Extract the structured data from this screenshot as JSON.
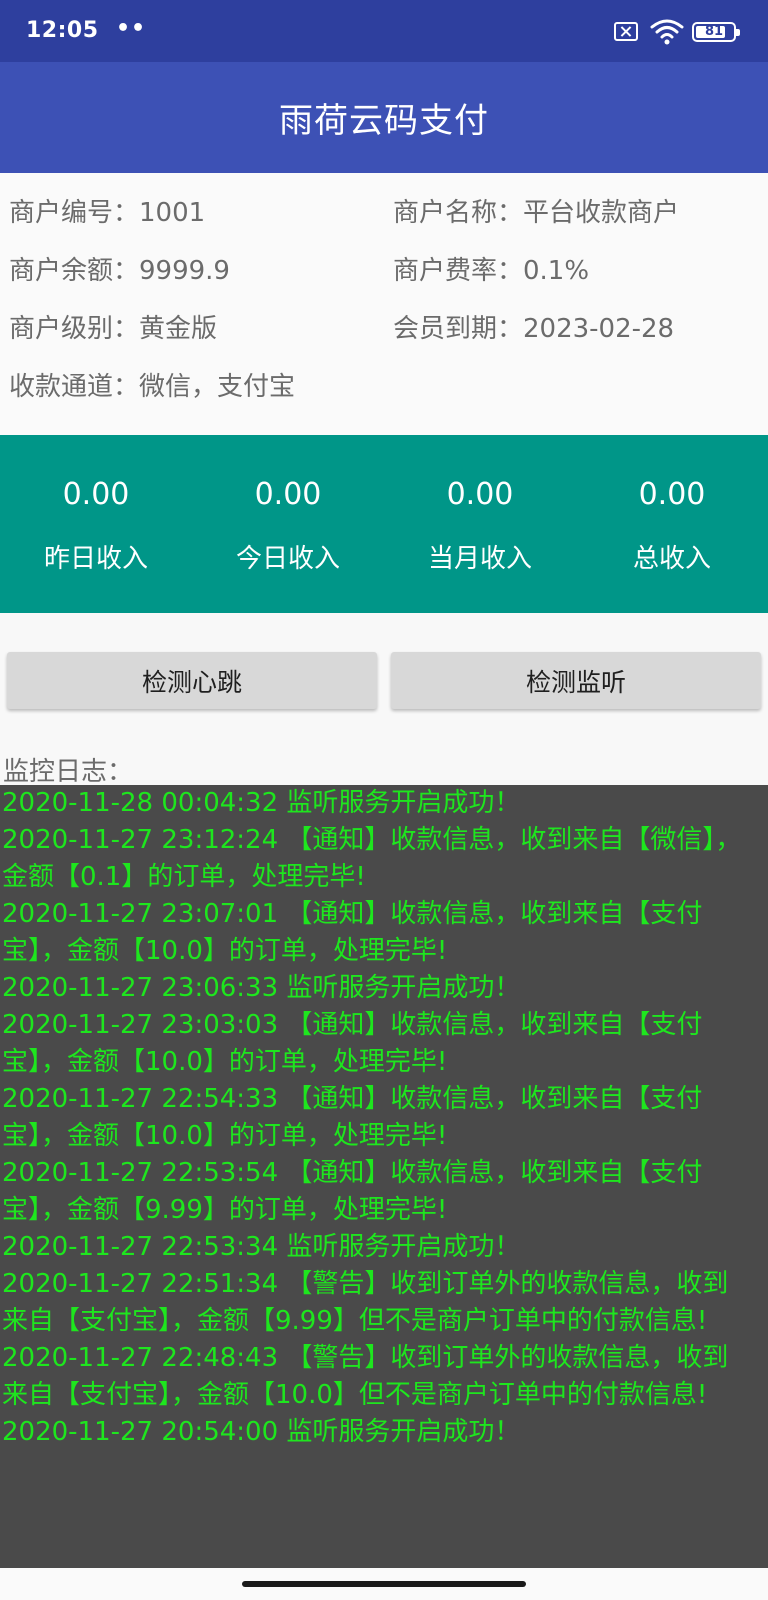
{
  "status_bar": {
    "time": "12:05",
    "dots": "••",
    "battery_level": 81,
    "battery_text": "81",
    "icons": [
      "sim-off-icon",
      "wifi-icon",
      "battery-icon"
    ]
  },
  "app_bar": {
    "title": "雨荷云码支付"
  },
  "merchant": {
    "id": "商户编号：1001",
    "name": "商户名称：平台收款商户",
    "balance": "商户余额：9999.9",
    "rate": "商户费率：0.1%",
    "level": "商户级别：黄金版",
    "expiry": "会员到期：2023-02-28",
    "channels": "收款通道：微信，支付宝"
  },
  "income": [
    {
      "value": "0.00",
      "label": "昨日收入"
    },
    {
      "value": "0.00",
      "label": "今日收入"
    },
    {
      "value": "0.00",
      "label": "当月收入"
    },
    {
      "value": "0.00",
      "label": "总收入"
    }
  ],
  "buttons": {
    "check_heartbeat": "检测心跳",
    "check_listener": "检测监听"
  },
  "log": {
    "title": "监控日志：",
    "lines": [
      "2020-11-28 00:04:32    监听服务开启成功！",
      "2020-11-27 23:12:24    【通知】收款信息，收到来自【微信】，",
      "金额【0.1】的订单，处理完毕!",
      "2020-11-27 23:07:01    【通知】收款信息，收到来自【支付",
      "宝】，金额【10.0】的订单，处理完毕!",
      "2020-11-27 23:06:33    监听服务开启成功！",
      "2020-11-27 23:03:03    【通知】收款信息，收到来自【支付",
      "宝】，金额【10.0】的订单，处理完毕!",
      "2020-11-27 22:54:33    【通知】收款信息，收到来自【支付",
      "宝】，金额【10.0】的订单，处理完毕!",
      "2020-11-27 22:53:54    【通知】收款信息，收到来自【支付",
      "宝】，金额【9.99】的订单，处理完毕!",
      "2020-11-27 22:53:34    监听服务开启成功！",
      "2020-11-27 22:51:34    【警告】收到订单外的收款信息，收到",
      "来自【支付宝】，金额【9.99】但不是商户订单中的付款信息!",
      "2020-11-27 22:48:43    【警告】收到订单外的收款信息，收到",
      "来自【支付宝】，金额【10.0】但不是商户订单中的付款信息!",
      "2020-11-27 20:54:00    监听服务开启成功！"
    ]
  },
  "colors": {
    "status_bar": "#2e3f9e",
    "app_bar": "#3d51b5",
    "income_panel": "#009688",
    "log_background": "#4a4a4a",
    "log_text": "#1ee61e"
  }
}
